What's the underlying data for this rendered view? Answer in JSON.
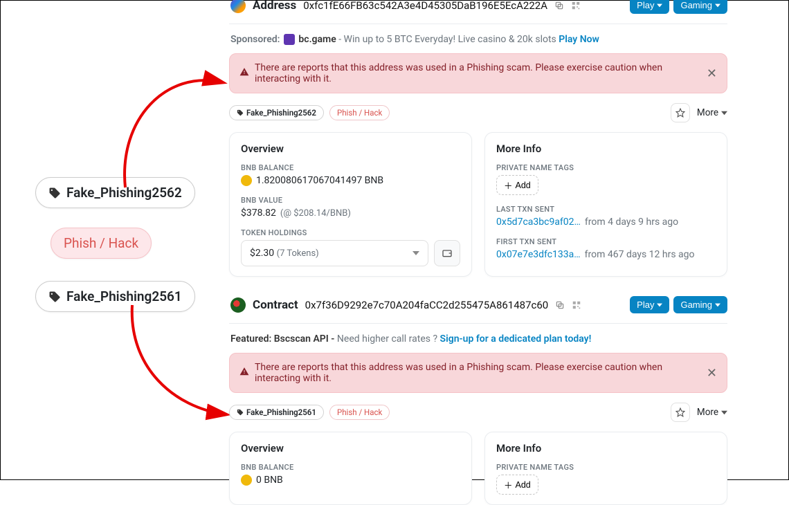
{
  "left": {
    "tag1": "Fake_Phishing2562",
    "tag2": "Phish / Hack",
    "tag3": "Fake_Phishing2561"
  },
  "buttons": {
    "play": "Play",
    "gaming": "Gaming",
    "more": "More",
    "add": "Add"
  },
  "block1": {
    "title": "Address",
    "address": "0xfc1fE66FB63c542A3e4D45305DaB196E5EcA222A",
    "sponsored_label": "Sponsored:",
    "sponsored_name": "bc.game",
    "sponsored_text": " - Win up to 5 BTC Everyday! Live casino & 20k slots ",
    "sponsored_link": "Play Now",
    "alert": "There are reports that this address was used in a Phishing scam. Please exercise caution when interacting with it.",
    "tag_primary": "Fake_Phishing2562",
    "tag_secondary": "Phish / Hack",
    "overview_title": "Overview",
    "bal_label": "BNB BALANCE",
    "bal_value": "1.820080617067041497 BNB",
    "val_label": "BNB VALUE",
    "val_value": "$378.82",
    "val_rate": "(@ $208.14/BNB)",
    "tokens_label": "TOKEN HOLDINGS",
    "tokens_value": "$2.30",
    "tokens_count": "(7 Tokens)",
    "moreinfo_title": "More Info",
    "pnt_label": "PRIVATE NAME TAGS",
    "last_label": "LAST TXN SENT",
    "last_hash": "0x5d7ca3bc9af02…",
    "last_time": "from 4 days 9 hrs ago",
    "first_label": "FIRST TXN SENT",
    "first_hash": "0x07e7e3dfc133a…",
    "first_time": "from 467 days 12 hrs ago"
  },
  "block2": {
    "title": "Contract",
    "address": "0x7f36D9292e7c70A204faCC2d255475A861487c60",
    "featured_label": "Featured: Bscscan API -",
    "featured_text": " Need higher call rates ? ",
    "featured_link": "Sign-up for a dedicated plan today!",
    "alert": "There are reports that this address was used in a Phishing scam. Please exercise caution when interacting with it.",
    "tag_primary": "Fake_Phishing2561",
    "tag_secondary": "Phish / Hack",
    "overview_title": "Overview",
    "bal_label": "BNB BALANCE",
    "bal_value": "0 BNB",
    "moreinfo_title": "More Info",
    "pnt_label": "PRIVATE NAME TAGS"
  }
}
